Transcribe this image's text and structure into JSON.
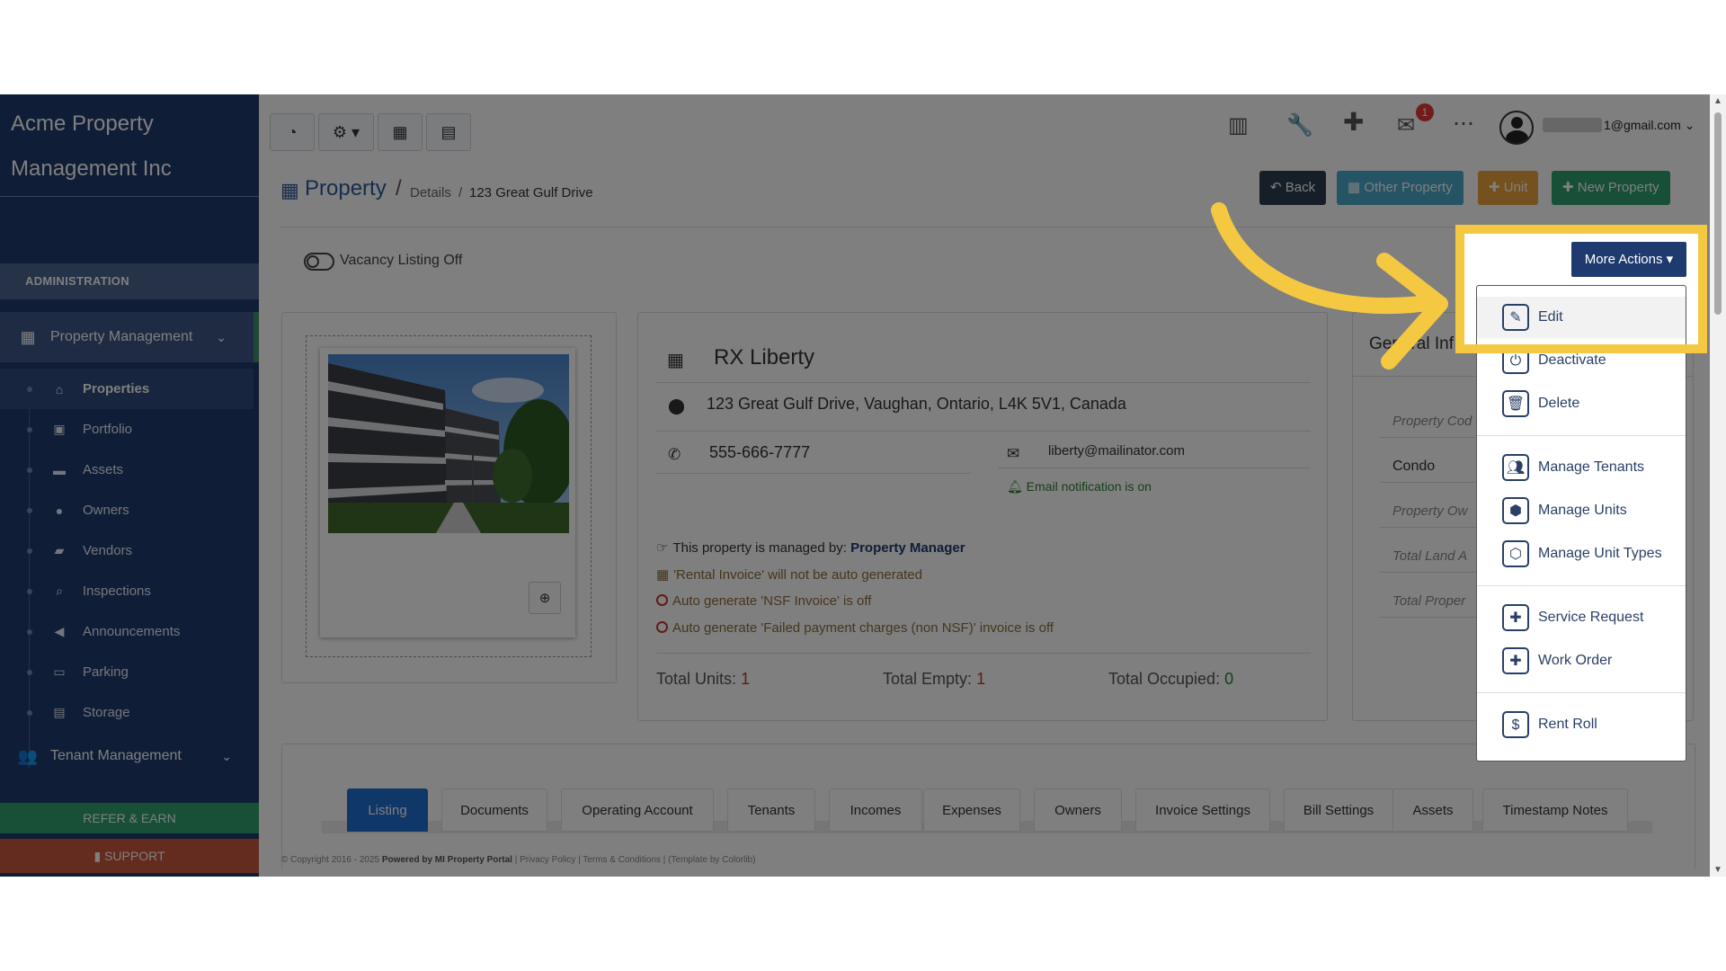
{
  "brand": {
    "name": "Acme Property Management Inc"
  },
  "sidebar": {
    "section": "ADMINISTRATION",
    "property_management": "Property Management",
    "items": [
      {
        "label": "Properties",
        "icon": "home-icon"
      },
      {
        "label": "Portfolio",
        "icon": "portfolio-icon"
      },
      {
        "label": "Assets",
        "icon": "box-icon"
      },
      {
        "label": "Owners",
        "icon": "user-icon"
      },
      {
        "label": "Vendors",
        "icon": "briefcase-icon"
      },
      {
        "label": "Inspections",
        "icon": "search-icon"
      },
      {
        "label": "Announcements",
        "icon": "bullhorn-icon"
      },
      {
        "label": "Parking",
        "icon": "car-icon"
      },
      {
        "label": "Storage",
        "icon": "storage-icon"
      }
    ],
    "tenant_management": "Tenant Management",
    "refer": "REFER & EARN",
    "support": "SUPPORT"
  },
  "header": {
    "notification_count": "1",
    "user_email": "1@gmail.com"
  },
  "breadcrumb": {
    "title": "Property",
    "sep": "/",
    "details": "Details",
    "sep2": "/",
    "current": "123 Great Gulf Drive"
  },
  "actions": {
    "back": "Back",
    "other_property": "Other Property",
    "unit": "Unit",
    "new_property": "New Property"
  },
  "vacancy": {
    "label": "Vacancy Listing Off"
  },
  "property": {
    "name": "RX Liberty",
    "address": "123 Great Gulf Drive, Vaughan, Ontario, L4K 5V1, Canada",
    "phone": "555-666-7777",
    "email": "liberty@mailinator.com",
    "email_notification": "Email notification is on",
    "managed_by_prefix": "This property is managed by:",
    "managed_by": "Property Manager",
    "msg_rental": "'Rental Invoice' will not be auto generated",
    "msg_nsf": "Auto generate 'NSF Invoice' is off",
    "msg_failed": "Auto generate 'Failed payment charges (non NSF)' invoice is off",
    "total_units_label": "Total Units:",
    "total_units": "1",
    "total_empty_label": "Total Empty:",
    "total_empty": "1",
    "total_occupied_label": "Total Occupied:",
    "total_occupied": "0"
  },
  "general": {
    "title": "General Inf",
    "field1": "Property Cod",
    "value1": "Condo",
    "field2": "Property Ow",
    "field3": "Total Land A",
    "field4": "Total Proper"
  },
  "tabs": [
    "Listing",
    "Documents",
    "Operating Account",
    "Tenants",
    "Incomes",
    "Expenses",
    "Owners",
    "Invoice Settings",
    "Bill Settings",
    "Assets",
    "Timestamp Notes"
  ],
  "footer": {
    "copyright": "© Copyright 2016 - 2025",
    "powered": "Powered by MI Property Portal",
    "links": "| Privacy Policy | Terms & Conditions |",
    "template": "(Template by Colorlib)"
  },
  "more_actions": {
    "button": "More Actions",
    "items": [
      {
        "label": "Edit",
        "icon": "edit-icon"
      },
      {
        "label": "Deactivate",
        "icon": "power-icon"
      },
      {
        "label": "Delete",
        "icon": "trash-icon"
      },
      {
        "label": "Manage Tenants",
        "icon": "users-icon"
      },
      {
        "label": "Manage Units",
        "icon": "cubes-icon"
      },
      {
        "label": "Manage Unit Types",
        "icon": "cube-icon"
      },
      {
        "label": "Service Request",
        "icon": "plus-square-icon"
      },
      {
        "label": "Work Order",
        "icon": "plus-square-icon"
      },
      {
        "label": "Rent Roll",
        "icon": "dollar-icon"
      }
    ]
  },
  "colors": {
    "highlight": "#f5c842",
    "primary": "#1f3a6e",
    "success": "#2e9f6e",
    "warning": "#e8a33d",
    "info": "#5bc0de"
  }
}
